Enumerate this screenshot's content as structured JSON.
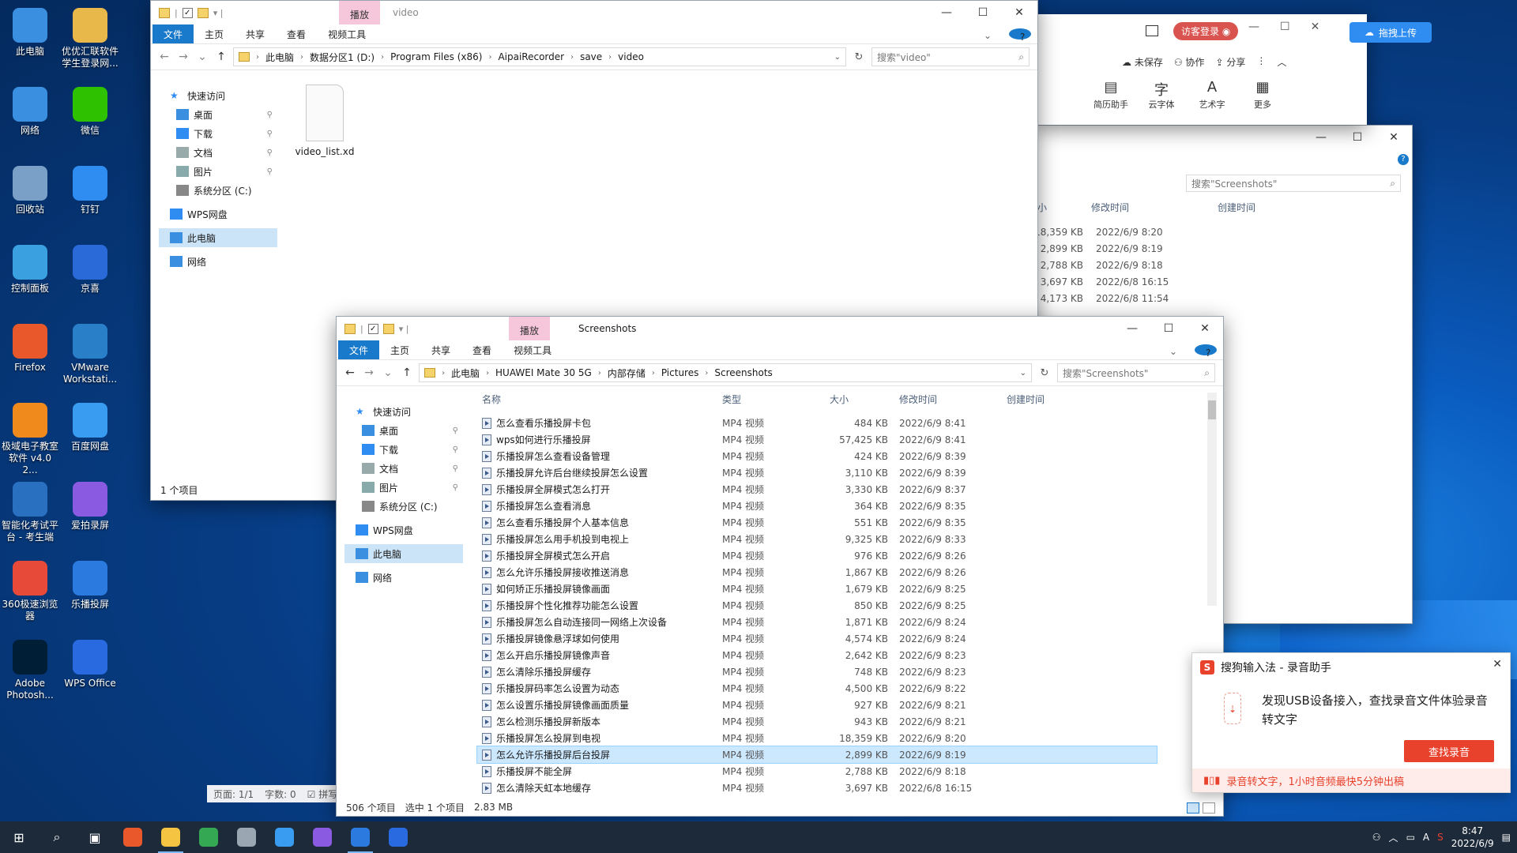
{
  "desktop_icons": [
    {
      "label": "此电脑",
      "icon": "computer-icon",
      "color": "#3a8fe0"
    },
    {
      "label": "优优汇联软件学生登录网...",
      "icon": "folder-icon",
      "color": "#e8b84a"
    },
    {
      "label": "网络",
      "icon": "network-icon",
      "color": "#3a8fe0"
    },
    {
      "label": "微信",
      "icon": "wechat-icon",
      "color": "#2dc100"
    },
    {
      "label": "回收站",
      "icon": "recycle-bin-icon",
      "color": "#7aa0c8"
    },
    {
      "label": "钉钉",
      "icon": "dingtalk-icon",
      "color": "#2f8cf0"
    },
    {
      "label": "控制面板",
      "icon": "control-panel-icon",
      "color": "#3aa0e0"
    },
    {
      "label": "京喜",
      "icon": "jingxi-icon",
      "color": "#2a6ad8"
    },
    {
      "label": "Firefox",
      "icon": "firefox-icon",
      "color": "#e8582a"
    },
    {
      "label": "VMware Workstati...",
      "icon": "vmware-icon",
      "color": "#2a80c8"
    },
    {
      "label": "极域电子教室软件 v4.0 2...",
      "icon": "jiyu-icon",
      "color": "#f08a1c"
    },
    {
      "label": "百度网盘",
      "icon": "baidu-netdisk-icon",
      "color": "#3a9cf0"
    },
    {
      "label": "智能化考试平台 - 考生端",
      "icon": "exam-icon",
      "color": "#2a70c0"
    },
    {
      "label": "爱拍录屏",
      "icon": "aipai-icon",
      "color": "#8a5ae0"
    },
    {
      "label": "360极速浏览器",
      "icon": "browser-360-icon",
      "color": "#e84a3a"
    },
    {
      "label": "乐播投屏",
      "icon": "lebo-icon",
      "color": "#2a7ae0"
    },
    {
      "label": "Adobe Photosh...",
      "icon": "photoshop-icon",
      "color": "#001e36"
    },
    {
      "label": "WPS Office",
      "icon": "wps-icon",
      "color": "#2a6ae0"
    }
  ],
  "win_video": {
    "context_tab": "播放",
    "title": "video",
    "ribbon_tabs": [
      "文件",
      "主页",
      "共享",
      "查看",
      "视频工具"
    ],
    "path": [
      "此电脑",
      "数据分区1 (D:)",
      "Program Files (x86)",
      "AipaiRecorder",
      "save",
      "video"
    ],
    "search_placeholder": "搜索\"video\"",
    "nav": [
      "快速访问",
      "桌面",
      "下载",
      "文档",
      "图片",
      "系统分区 (C:)",
      "WPS网盘",
      "此电脑",
      "网络"
    ],
    "file": "video_list.xd",
    "status": "1 个项目"
  },
  "win_behind": {
    "search_placeholder": "搜索\"Screenshots\"",
    "headers": [
      "大小",
      "修改时间",
      "创建时间"
    ],
    "rows": [
      {
        "size": "18,359 KB",
        "date": "2022/6/9 8:20"
      },
      {
        "size": "2,899 KB",
        "date": "2022/6/9 8:19"
      },
      {
        "size": "2,788 KB",
        "date": "2022/6/9 8:18"
      },
      {
        "size": "3,697 KB",
        "date": "2022/6/8 16:15"
      },
      {
        "size": "4,173 KB",
        "date": "2022/6/8 11:54"
      }
    ]
  },
  "wps_toolbar": {
    "login": "访客登录",
    "unsaved": "未保存",
    "collab": "协作",
    "share": "分享",
    "tools": [
      "简历助手",
      "云字体",
      "艺术字",
      "更多"
    ]
  },
  "baidu_upload": "拖拽上传",
  "bottom_status": {
    "page": "页面: 1/1",
    "words": "字数: 0",
    "spell": "拼写"
  },
  "win_shots": {
    "context_tab": "播放",
    "title": "Screenshots",
    "ribbon_tabs": [
      "文件",
      "主页",
      "共享",
      "查看",
      "视频工具"
    ],
    "path": [
      "此电脑",
      "HUAWEI Mate 30 5G",
      "内部存储",
      "Pictures",
      "Screenshots"
    ],
    "search_placeholder": "搜索\"Screenshots\"",
    "nav": [
      "快速访问",
      "桌面",
      "下载",
      "文档",
      "图片",
      "系统分区 (C:)",
      "WPS网盘",
      "此电脑",
      "网络"
    ],
    "headers": {
      "name": "名称",
      "type": "类型",
      "size": "大小",
      "mtime": "修改时间",
      "ctime": "创建时间"
    },
    "files": [
      {
        "name": "怎么查看乐播投屏卡包",
        "type": "MP4 视频",
        "size": "484 KB",
        "date": "2022/6/9 8:41"
      },
      {
        "name": "wps如何进行乐播投屏",
        "type": "MP4 视频",
        "size": "57,425 KB",
        "date": "2022/6/9 8:41"
      },
      {
        "name": "乐播投屏怎么查看设备管理",
        "type": "MP4 视频",
        "size": "424 KB",
        "date": "2022/6/9 8:39"
      },
      {
        "name": "乐播投屏允许后台继续投屏怎么设置",
        "type": "MP4 视频",
        "size": "3,110 KB",
        "date": "2022/6/9 8:39"
      },
      {
        "name": "乐播投屏全屏模式怎么打开",
        "type": "MP4 视频",
        "size": "3,330 KB",
        "date": "2022/6/9 8:37"
      },
      {
        "name": "乐播投屏怎么查看消息",
        "type": "MP4 视频",
        "size": "364 KB",
        "date": "2022/6/9 8:35"
      },
      {
        "name": "怎么查看乐播投屏个人基本信息",
        "type": "MP4 视频",
        "size": "551 KB",
        "date": "2022/6/9 8:35"
      },
      {
        "name": "乐播投屏怎么用手机投到电视上",
        "type": "MP4 视频",
        "size": "9,325 KB",
        "date": "2022/6/9 8:33"
      },
      {
        "name": "乐播投屏全屏模式怎么开启",
        "type": "MP4 视频",
        "size": "976 KB",
        "date": "2022/6/9 8:26"
      },
      {
        "name": "怎么允许乐播投屏接收推送消息",
        "type": "MP4 视频",
        "size": "1,867 KB",
        "date": "2022/6/9 8:26"
      },
      {
        "name": "如何矫正乐播投屏镜像画面",
        "type": "MP4 视频",
        "size": "1,679 KB",
        "date": "2022/6/9 8:25"
      },
      {
        "name": "乐播投屏个性化推荐功能怎么设置",
        "type": "MP4 视频",
        "size": "850 KB",
        "date": "2022/6/9 8:25"
      },
      {
        "name": "乐播投屏怎么自动连接同一网络上次设备",
        "type": "MP4 视频",
        "size": "1,871 KB",
        "date": "2022/6/9 8:24"
      },
      {
        "name": "乐播投屏镜像悬浮球如何使用",
        "type": "MP4 视频",
        "size": "4,574 KB",
        "date": "2022/6/9 8:24"
      },
      {
        "name": "怎么开启乐播投屏镜像声音",
        "type": "MP4 视频",
        "size": "2,642 KB",
        "date": "2022/6/9 8:23"
      },
      {
        "name": "怎么清除乐播投屏缓存",
        "type": "MP4 视频",
        "size": "748 KB",
        "date": "2022/6/9 8:23"
      },
      {
        "name": "乐播投屏码率怎么设置为动态",
        "type": "MP4 视频",
        "size": "4,500 KB",
        "date": "2022/6/9 8:22"
      },
      {
        "name": "怎么设置乐播投屏镜像画面质量",
        "type": "MP4 视频",
        "size": "927 KB",
        "date": "2022/6/9 8:21"
      },
      {
        "name": "怎么检测乐播投屏新版本",
        "type": "MP4 视频",
        "size": "943 KB",
        "date": "2022/6/9 8:21"
      },
      {
        "name": "乐播投屏怎么投屏到电视",
        "type": "MP4 视频",
        "size": "18,359 KB",
        "date": "2022/6/9 8:20"
      },
      {
        "name": "怎么允许乐播投屏后台投屏",
        "type": "MP4 视频",
        "size": "2,899 KB",
        "date": "2022/6/9 8:19",
        "selected": true
      },
      {
        "name": "乐播投屏不能全屏",
        "type": "MP4 视频",
        "size": "2,788 KB",
        "date": "2022/6/9 8:18"
      },
      {
        "name": "怎么清除天虹本地缓存",
        "type": "MP4 视频",
        "size": "3,697 KB",
        "date": "2022/6/8 16:15"
      }
    ],
    "status": {
      "count": "506 个项目",
      "selected": "选中 1 个项目",
      "size": "2.83 MB"
    }
  },
  "sogou_popup": {
    "title": "搜狗输入法 - 录音助手",
    "message": "发现USB设备接入，查找录音文件体验录音转文字",
    "button": "查找录音",
    "footer": "录音转文字，1小时音频最快5分钟出稿"
  },
  "taskbar": {
    "time": "8:47",
    "date": "2022/6/9",
    "apps": [
      "start-icon",
      "search-icon",
      "task-view-icon",
      "firefox-icon",
      "file-explorer-icon",
      "chrome-icon",
      "printer-icon",
      "baidu-netdisk-icon",
      "aipai-icon",
      "lebo-icon",
      "wps-icon"
    ]
  },
  "colors": {
    "accent": "#1979ca",
    "context_tab": "#f6c6da",
    "selection": "#cce8ff",
    "sogou_red": "#e8412c"
  }
}
